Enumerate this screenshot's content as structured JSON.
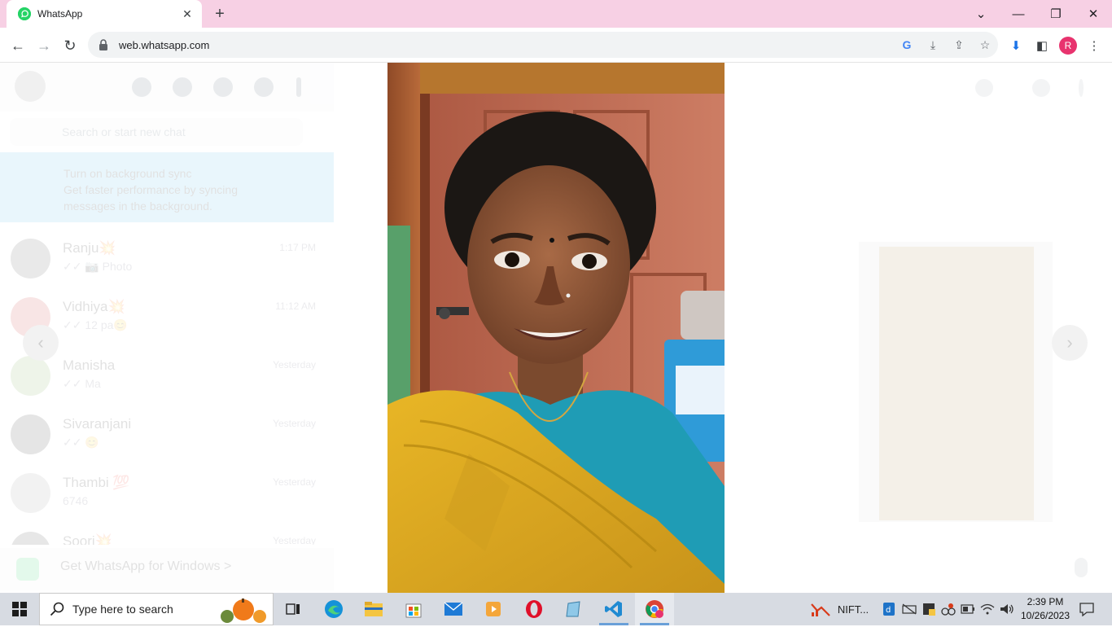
{
  "browser": {
    "tab_title": "WhatsApp",
    "tab_close": "✕",
    "new_tab": "+",
    "url": "web.whatsapp.com",
    "profile_initial": "R",
    "window_controls": {
      "dropdown": "⌄",
      "minimize": "—",
      "restore": "❐",
      "close": "✕"
    },
    "nav": {
      "back": "←",
      "forward": "→",
      "reload": "↻"
    },
    "icons": {
      "google": "G",
      "install": "⤓",
      "share": "⇪",
      "bookmark": "☆",
      "downloads": "⬇",
      "sidepanel": "◧",
      "menu": "⋮"
    }
  },
  "whatsapp": {
    "search_placeholder": "Search or start new chat",
    "notice": {
      "title": "Turn on background sync",
      "body": "Get faster performance by syncing messages in the background."
    },
    "chats": [
      {
        "name": "Ranju💥",
        "time": "1:17 PM",
        "message": "✓✓ 📷 Photo"
      },
      {
        "name": "Vidhiya💥",
        "time": "11:12 AM",
        "message": "✓✓ 12 pa😊"
      },
      {
        "name": "Manisha",
        "time": "Yesterday",
        "message": "✓✓ Ma"
      },
      {
        "name": "Sivaranjani",
        "time": "Yesterday",
        "message": "✓✓ 😊"
      },
      {
        "name": "Thambi 💯",
        "time": "Yesterday",
        "message": "6746"
      },
      {
        "name": "Soori💥",
        "time": "Yesterday",
        "message": ""
      }
    ],
    "get_windows": "Get WhatsApp for Windows  >",
    "prev_arrow": "‹",
    "next_arrow": "›"
  },
  "taskbar": {
    "search_placeholder": "Type here to search",
    "tray_app_label": "NIFT...",
    "time": "2:39 PM",
    "date": "10/26/2023"
  },
  "colors": {
    "tab_strip": "#f7d0e4",
    "whatsapp_green": "#25d366",
    "profile": "#e8336e",
    "taskbar": "#d7dbe2"
  }
}
